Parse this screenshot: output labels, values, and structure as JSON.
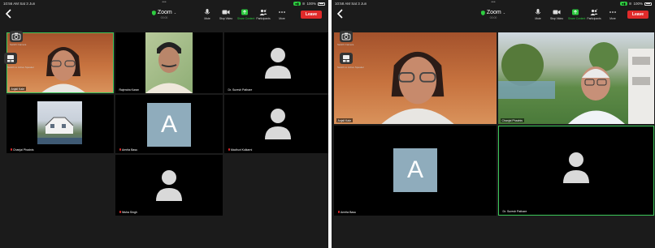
{
  "colors": {
    "active_border": "#3cc85a",
    "leave": "#e02a2a",
    "accent_green": "#2ecc40",
    "avatar_bg": "#8facbc"
  },
  "left": {
    "status": {
      "time": "10:56 AM  Sat 3 Jun",
      "battery": "100%"
    },
    "title": "Zoom",
    "subtitle": "00:00",
    "tools": [
      {
        "label": "Mute",
        "icon": "mic-icon"
      },
      {
        "label": "Stop Video",
        "icon": "video-camera-icon"
      },
      {
        "label": "Share Content",
        "icon": "share-icon"
      },
      {
        "label": "Participants",
        "icon": "participants-icon",
        "count": "7"
      },
      {
        "label": "More",
        "icon": "more-icon"
      }
    ],
    "leave": "Leave",
    "float_labels": [
      "Switch Camera",
      "Switch to Active Speaker"
    ],
    "tiles": [
      {
        "name": "Anjali Kale"
      },
      {
        "name": "Rajendra Karan"
      },
      {
        "name": "Dr. Suresh Pathare"
      },
      {
        "name": "Chanjai Phadnis"
      },
      {
        "name": "Amrita Basu",
        "initial": "A"
      },
      {
        "name": "Madhuri Kulkarni"
      },
      {
        "name": "Nisha Singh"
      }
    ]
  },
  "right": {
    "status": {
      "time": "10:58 AM  Sat 3 Jun",
      "battery": "100%"
    },
    "title": "Zoom",
    "subtitle": "00:00",
    "tools": [
      {
        "label": "Mute",
        "icon": "mic-icon"
      },
      {
        "label": "Stop Video",
        "icon": "video-camera-icon"
      },
      {
        "label": "Share Content",
        "icon": "share-icon"
      },
      {
        "label": "Participants",
        "icon": "participants-icon",
        "count": "4"
      },
      {
        "label": "More",
        "icon": "more-icon"
      }
    ],
    "leave": "Leave",
    "float_labels": [
      "Switch Camera",
      "Switch to Active Speaker"
    ],
    "tiles": [
      {
        "name": "Anjali Kale"
      },
      {
        "name": "Chanjai Phadnis"
      },
      {
        "name": "Amrita Basu",
        "initial": "A"
      },
      {
        "name": "Dr. Suresh Pathare"
      }
    ]
  }
}
